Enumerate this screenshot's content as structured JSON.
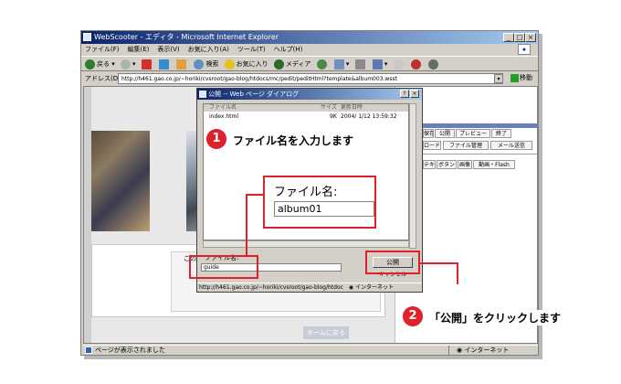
{
  "browser": {
    "title": "WebScooter - エディタ - Microsoft Internet Explorer",
    "menu": [
      "ファイル(F)",
      "編集(E)",
      "表示(V)",
      "お気に入り(A)",
      "ツール(T)",
      "ヘルプ(H)"
    ],
    "toolbar": {
      "back": "戻る",
      "search": "検索",
      "favorites": "お気に入り",
      "media": "メディア"
    },
    "address_label": "アドレス(D)",
    "address_url": "http://h461.gao.co.jp/~horiki/cvsroot/gao-blog/htdocs/mc/pedit/peditHtml?template&album003.wsst",
    "go_label": "移動",
    "status_text": "ページが表示されました",
    "zone": "インターネット"
  },
  "page": {
    "tabs1": [
      "保存",
      "公開",
      "プレビュー",
      "終了"
    ],
    "tabs2": [
      "ロード",
      "ファイル管理",
      "メール送信"
    ],
    "tabs3": [
      "テキスト",
      "ボタン",
      "画像",
      "動画・Flash"
    ],
    "partial_text": "この",
    "home_button": "ホームに戻る"
  },
  "dialog": {
    "title": "公開 -- Web ページ ダイアログ",
    "columns": {
      "name": "ファイル名",
      "size": "サイズ",
      "date": "更新日時"
    },
    "rows": [
      {
        "name": "index.html",
        "size": "9K",
        "date": "2004/ 1/12 13:59:32"
      }
    ],
    "filename_label": "ファイル名:",
    "filename_value": "guide",
    "publish_button": "公開",
    "cancel_button": "キャンセル",
    "status_url": "http://h461.gao.co.jp/~horiki/cvsroot/gao-blog/htdoc",
    "status_zone": "インターネット"
  },
  "callout": {
    "zoom_label": "ファイル名:",
    "zoom_value": "album01",
    "step1_number": "1",
    "step1_text": "ファイル名を入力します",
    "step2_number": "2",
    "step2_text": "「公開」をクリックします",
    "accent_color": "#e0202a"
  }
}
